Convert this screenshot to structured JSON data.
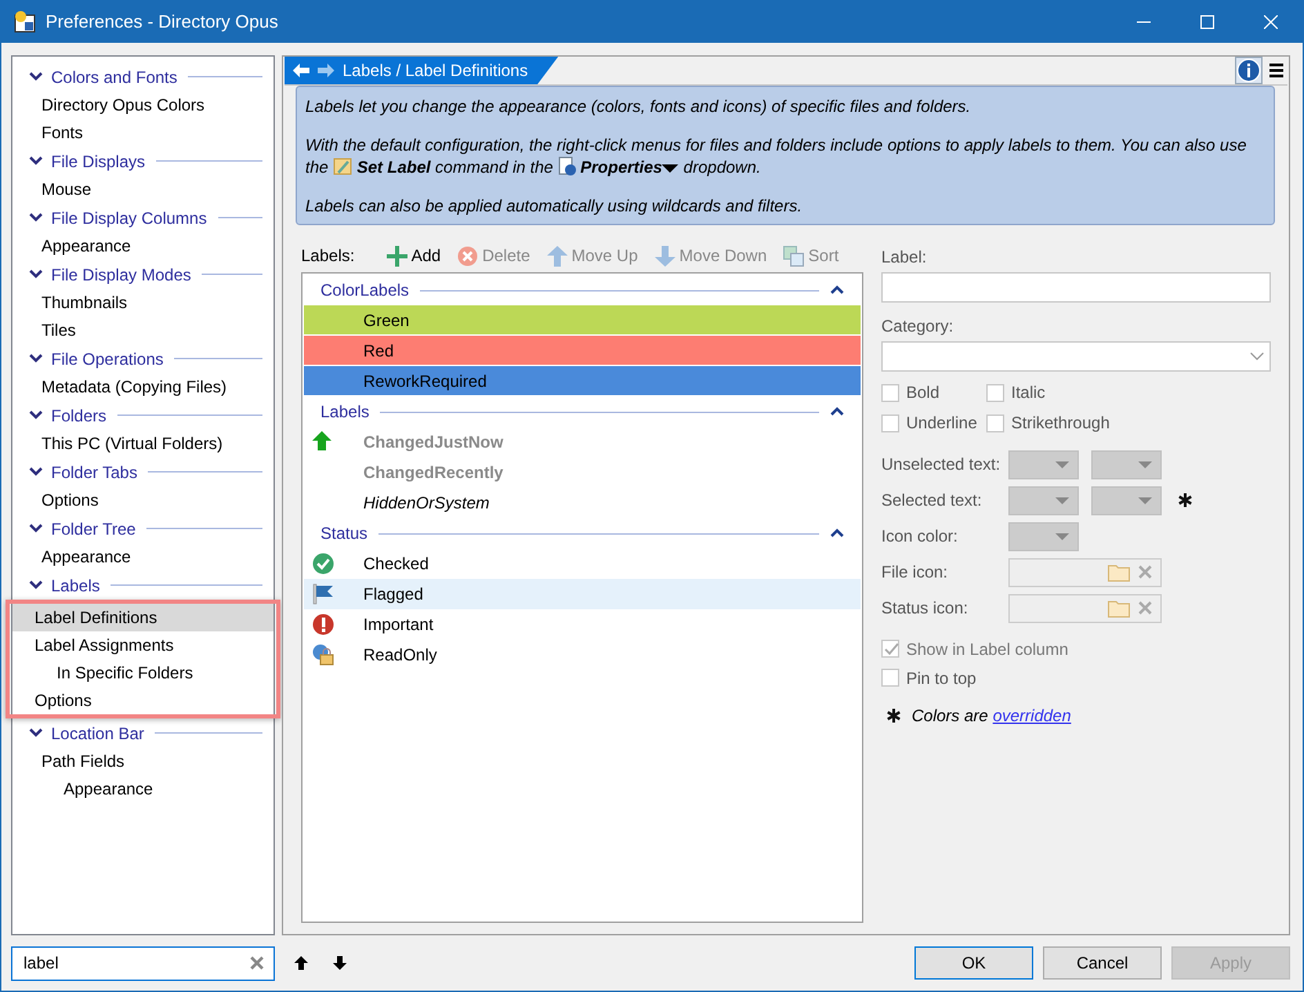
{
  "window": {
    "title": "Preferences - Directory Opus"
  },
  "sidebar": {
    "groups": [
      {
        "title": "Colors and Fonts",
        "expanded": true,
        "highlighted": false,
        "items": [
          {
            "label": "Directory Opus Colors",
            "selected": false
          },
          {
            "label": "Fonts",
            "selected": false
          }
        ]
      },
      {
        "title": "File Displays",
        "expanded": true,
        "highlighted": false,
        "items": [
          {
            "label": "Mouse",
            "selected": false
          }
        ]
      },
      {
        "title": "File Display Columns",
        "expanded": true,
        "highlighted": false,
        "items": [
          {
            "label": "Appearance",
            "selected": false
          }
        ]
      },
      {
        "title": "File Display Modes",
        "expanded": true,
        "highlighted": false,
        "items": [
          {
            "label": "Thumbnails",
            "selected": false
          },
          {
            "label": "Tiles",
            "selected": false
          }
        ]
      },
      {
        "title": "File Operations",
        "expanded": true,
        "highlighted": false,
        "items": [
          {
            "label": "Metadata (Copying Files)",
            "selected": false
          }
        ]
      },
      {
        "title": "Folders",
        "expanded": true,
        "highlighted": false,
        "items": [
          {
            "label": "This PC (Virtual Folders)",
            "selected": false
          }
        ]
      },
      {
        "title": "Folder Tabs",
        "expanded": true,
        "highlighted": false,
        "items": [
          {
            "label": "Options",
            "selected": false
          }
        ]
      },
      {
        "title": "Folder Tree",
        "expanded": true,
        "highlighted": false,
        "items": [
          {
            "label": "Appearance",
            "selected": false
          }
        ]
      },
      {
        "title": "Labels",
        "expanded": true,
        "highlighted": true,
        "items": [
          {
            "label": "Label Definitions",
            "selected": true
          },
          {
            "label": "Label Assignments",
            "selected": false,
            "children": [
              {
                "label": "In Specific Folders",
                "selected": false
              }
            ]
          },
          {
            "label": "Options",
            "selected": false
          }
        ]
      },
      {
        "title": "Location Bar",
        "expanded": true,
        "highlighted": false,
        "items": [
          {
            "label": "Path Fields",
            "selected": false,
            "children": [
              {
                "label": "Appearance",
                "selected": false
              }
            ]
          }
        ]
      }
    ]
  },
  "search": {
    "value": "label"
  },
  "breadcrumb": {
    "path": "Labels / Label Definitions"
  },
  "info": {
    "intro": "Labels let you change the appearance (colors, fonts and icons) of specific files and folders.",
    "usage": {
      "before": "With the default configuration, the right-click menus for files and folders include options to apply labels to them. You can also use the",
      "command": "Set Label",
      "middle": "command in the",
      "menu": "Properties",
      "after": "dropdown."
    },
    "outro": "Labels can also be applied automatically using wildcards and filters."
  },
  "toolbar": {
    "label": "Labels:",
    "buttons": [
      {
        "kind": "add",
        "label": "Add",
        "disabled": false
      },
      {
        "kind": "delete",
        "label": "Delete",
        "disabled": true
      },
      {
        "kind": "up",
        "label": "Move Up",
        "disabled": true
      },
      {
        "kind": "down",
        "label": "Move Down",
        "disabled": true
      },
      {
        "kind": "sort",
        "label": "Sort",
        "disabled": true
      }
    ]
  },
  "label_list": {
    "groups": [
      {
        "title": "ColorLabels",
        "expanded": true,
        "items": [
          {
            "kind": "color",
            "name": "Green",
            "color": "#bcd856",
            "selected": false
          },
          {
            "kind": "color",
            "name": "Red",
            "color": "#fd7d72",
            "selected": false
          },
          {
            "kind": "color",
            "name": "ReworkRequired",
            "color": "#4a8ada",
            "selected": false
          }
        ]
      },
      {
        "title": "Labels",
        "expanded": true,
        "items": [
          {
            "kind": "arrow",
            "name": "ChangedJustNow",
            "bold": true,
            "italic": false,
            "dimmed": true,
            "selected": false
          },
          {
            "kind": "plain",
            "name": "ChangedRecently",
            "bold": true,
            "italic": false,
            "dimmed": true,
            "selected": false
          },
          {
            "kind": "plain",
            "name": "HiddenOrSystem",
            "bold": false,
            "italic": true,
            "dimmed": false,
            "selected": false
          }
        ]
      },
      {
        "title": "Status",
        "expanded": true,
        "items": [
          {
            "kind": "check",
            "name": "Checked",
            "selected": false
          },
          {
            "kind": "flag",
            "name": "Flagged",
            "selected": true
          },
          {
            "kind": "alert",
            "name": "Important",
            "selected": false
          },
          {
            "kind": "lock",
            "name": "ReadOnly",
            "selected": false
          }
        ]
      }
    ]
  },
  "form": {
    "label_field": {
      "label": "Label:"
    },
    "category_field": {
      "label": "Category:"
    },
    "styles": [
      {
        "label": "Bold",
        "checked": false
      },
      {
        "label": "Italic",
        "checked": false
      },
      {
        "label": "Underline",
        "checked": false
      },
      {
        "label": "Strikethrough",
        "checked": false
      }
    ],
    "color_rows": [
      {
        "label": "Unselected text:",
        "kind": "pair",
        "overridden": false
      },
      {
        "label": "Selected text:",
        "kind": "pair",
        "overridden": true
      },
      {
        "label": "Icon color:",
        "kind": "single",
        "overridden": false
      }
    ],
    "icon_rows": [
      {
        "label": "File icon:"
      },
      {
        "label": "Status icon:"
      }
    ],
    "options": [
      {
        "label": "Show in Label column",
        "checked": true,
        "disabled": true
      },
      {
        "label": "Pin to top",
        "checked": false,
        "disabled": false
      }
    ],
    "note": {
      "text": "Colors are",
      "link": "overridden"
    }
  },
  "buttons": [
    {
      "label": "OK",
      "disabled": false,
      "default": true
    },
    {
      "label": "Cancel",
      "disabled": false,
      "default": false
    },
    {
      "label": "Apply",
      "disabled": true,
      "default": false
    }
  ]
}
